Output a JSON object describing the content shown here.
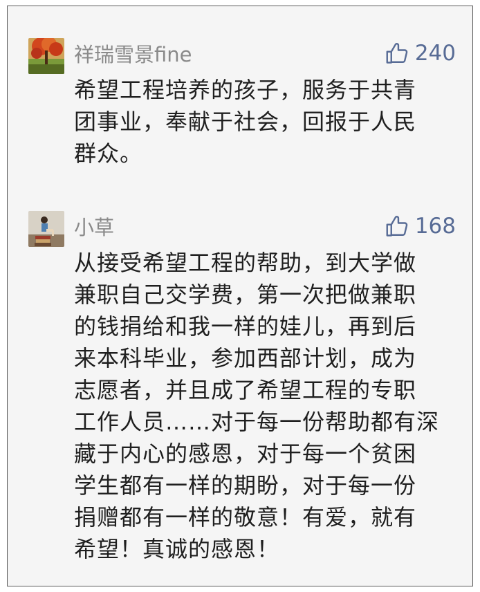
{
  "comments": [
    {
      "username": "祥瑞雪景fine",
      "likes": "240",
      "avatar_icon": "autumn-tree-avatar",
      "text_lines": [
        "希望工程培养的孩子，服务于共青",
        "团事业，奉献于社会，回报于人民",
        "群众。"
      ]
    },
    {
      "username": "小草",
      "likes": "168",
      "avatar_icon": "girl-on-books-avatar",
      "text_lines": [
        "从接受希望工程的帮助，到大学做",
        "兼职自己交学费，第一次把做兼职",
        "的钱捐给和我一样的娃儿，再到后",
        "来本科毕业，参加西部计划，成为",
        "志愿者，并且成了希望工程的专职",
        "工作人员……对于每一份帮助都有深",
        "藏于内心的感恩，对于每一个贫困",
        "学生都有一样的期盼，对于每一份",
        "捐赠都有一样的敬意！有爱，就有",
        "希望！真诚的感恩！"
      ]
    }
  ],
  "colors": {
    "background": "#f5f5f5",
    "username": "#8a8a8a",
    "like": "#576b95",
    "text": "#1f1f1f"
  }
}
